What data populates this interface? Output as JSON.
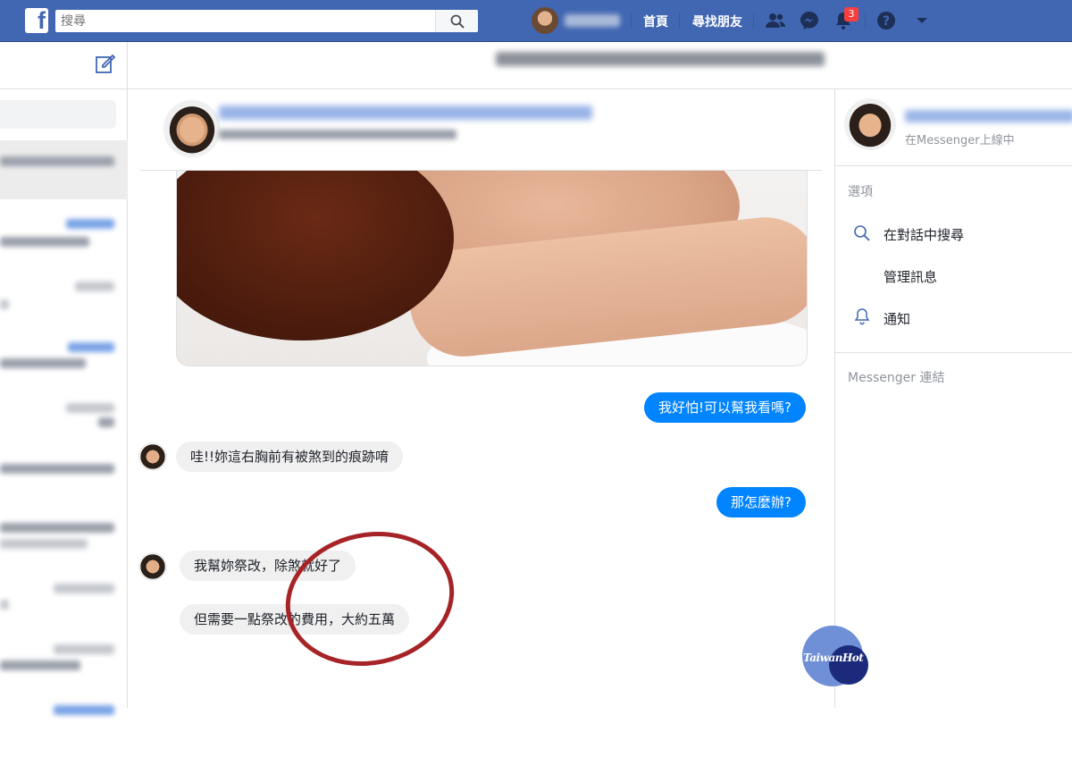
{
  "topbar": {
    "search_placeholder": "搜尋",
    "nav_home": "首頁",
    "nav_find_friends": "尋找朋友",
    "notification_count": "3",
    "accent": "#4267b2"
  },
  "messages": [
    {
      "dir": "out",
      "text": "我好怕!可以幫我看嗎?"
    },
    {
      "dir": "in",
      "text": "哇!!妳這右胸前有被煞到的痕跡唷"
    },
    {
      "dir": "out",
      "text": "那怎麼辦?"
    },
    {
      "dir": "in",
      "text": "我幫妳祭改，除煞就好了"
    },
    {
      "dir": "in",
      "text": "但需要一點祭改的費用，大約五萬"
    }
  ],
  "right_panel": {
    "status": "在Messenger上線中",
    "options_heading": "選項",
    "search_in_conversation": "在對話中搜尋",
    "manage_messages": "管理訊息",
    "notifications": "通知",
    "messenger_links": "Messenger 連結"
  },
  "watermark": {
    "text": "TaiwanHot"
  },
  "colors": {
    "outgoing_bubble": "#0084ff",
    "incoming_bubble": "#f1f0f0",
    "annotation_circle": "#a62327"
  }
}
